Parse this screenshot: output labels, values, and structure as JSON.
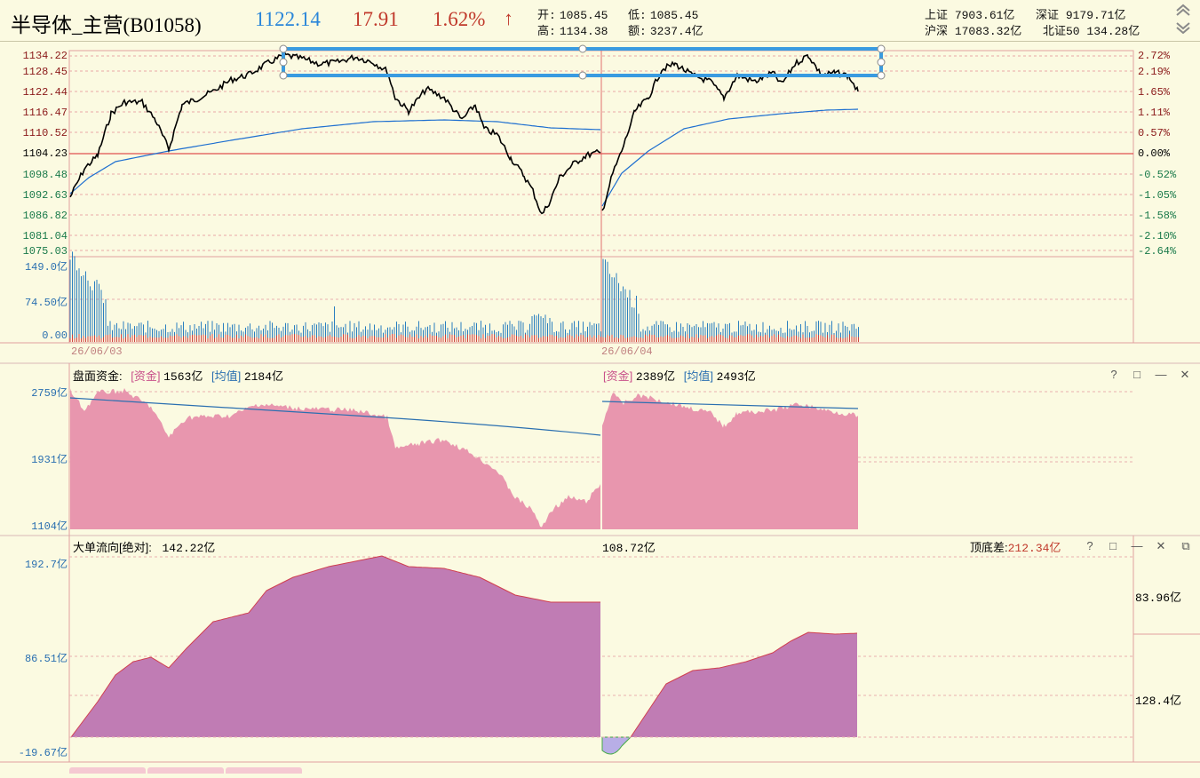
{
  "header": {
    "title": "半导体_主营(B01058)",
    "price": "1122.14",
    "change": "17.91",
    "change_pct": "1.62%",
    "arrow": "↑",
    "open_label": "开:",
    "open": "1085.45",
    "low_label": "低:",
    "low": "1085.45",
    "high_label": "高:",
    "high": "1134.38",
    "amount_label": "额:",
    "amount": "3237.4亿",
    "indices": [
      {
        "name": "上证",
        "value": "7903.61亿"
      },
      {
        "name": "深证",
        "value": "9179.71亿"
      },
      {
        "name": "沪深",
        "value": "17083.32亿"
      },
      {
        "name": "北证50",
        "value": "134.28亿"
      }
    ],
    "icons": [
      "scroll-up-icon",
      "scroll-down-icon"
    ]
  },
  "price_panel": {
    "left_ticks": [
      "1134.22",
      "1128.45",
      "1122.44",
      "1116.47",
      "1110.52",
      "1104.23",
      "1098.48",
      "1092.63",
      "1086.82",
      "1081.04",
      "1075.03"
    ],
    "right_ticks": [
      "2.72%",
      "2.19%",
      "1.65%",
      "1.11%",
      "0.57%",
      "0.00%",
      "-0.52%",
      "-1.05%",
      "-1.58%",
      "-2.10%",
      "-2.64%"
    ],
    "vol_ticks": [
      "149.0亿",
      "74.50亿",
      "0.00"
    ],
    "dates": [
      "26/06/03",
      "26/06/04"
    ]
  },
  "fund_panel": {
    "title": "盘面资金:",
    "left_tag": "[资金]",
    "left_value": "1563亿",
    "left_avg_tag": "[均值]",
    "left_avg": "2184亿",
    "right_tag": "[资金]",
    "right_value": "2389亿",
    "right_avg_tag": "[均值]",
    "right_avg": "2493亿",
    "ticks": [
      "2759亿",
      "1931亿",
      "1104亿"
    ],
    "controls": [
      "?",
      "□",
      "—",
      "✕"
    ]
  },
  "flow_panel": {
    "title": "大单流向[绝对]:",
    "left_value": "142.22亿",
    "right_value": "108.72亿",
    "diff_label": "顶底差:",
    "diff_value": "212.34亿",
    "ticks": [
      "192.7亿",
      "86.51亿",
      "-19.67亿"
    ],
    "right_ticks": [
      "83.96亿",
      "128.4亿"
    ],
    "controls": [
      "?",
      "□",
      "—",
      "✕",
      "⧉"
    ]
  },
  "colors": {
    "price_line": "#000000",
    "avg_line": "#1e6fd0",
    "zero_line": "#e05050",
    "fund_fill": "#e896ae",
    "flow_fill": "#c07cb4",
    "flow_neg_fill": "#b8aee6",
    "up": "#c0392b",
    "accent_blue": "#2a86d9",
    "selection": "#3a9be0"
  }
}
